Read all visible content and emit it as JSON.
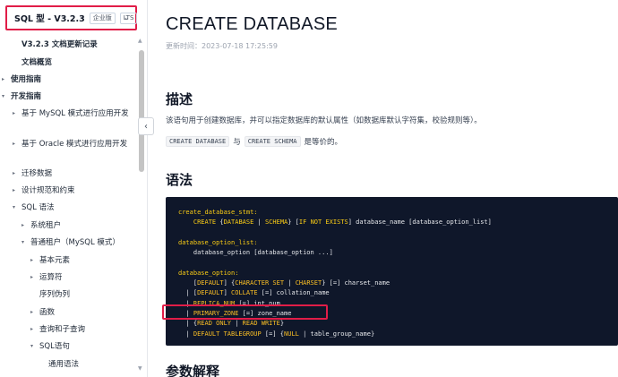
{
  "sidebar": {
    "version": "SQL 型 - V3.2.3",
    "tags": [
      "企业版",
      "LTS"
    ],
    "items": [
      {
        "label": "V3.2.3 文档更新记录",
        "indent": 1,
        "caret": "",
        "bold": true
      },
      {
        "label": "文档概览",
        "indent": 1,
        "caret": "",
        "bold": true
      },
      {
        "label": "使用指南",
        "indent": 0,
        "caret": "▸",
        "bold": true
      },
      {
        "label": "开发指南",
        "indent": 0,
        "caret": "▾",
        "bold": true
      },
      {
        "label": "基于 MySQL 模式进行应用开发",
        "indent": 1,
        "caret": "▸",
        "bold": false
      },
      {
        "label": "基于 Oracle 模式进行应用开发",
        "indent": 1,
        "caret": "▸",
        "bold": false
      },
      {
        "label": "迁移数据",
        "indent": 1,
        "caret": "▸",
        "bold": false
      },
      {
        "label": "设计规范和约束",
        "indent": 1,
        "caret": "▸",
        "bold": false
      },
      {
        "label": "SQL 语法",
        "indent": 1,
        "caret": "▾",
        "bold": false
      },
      {
        "label": "系统租户",
        "indent": 2,
        "caret": "▸",
        "bold": false
      },
      {
        "label": "普通租户（MySQL 模式）",
        "indent": 2,
        "caret": "▾",
        "bold": false
      },
      {
        "label": "基本元素",
        "indent": 3,
        "caret": "▸",
        "bold": false
      },
      {
        "label": "运算符",
        "indent": 3,
        "caret": "▸",
        "bold": false
      },
      {
        "label": "序列伪列",
        "indent": 3,
        "caret": "",
        "bold": false
      },
      {
        "label": "函数",
        "indent": 3,
        "caret": "▸",
        "bold": false
      },
      {
        "label": "查询和子查询",
        "indent": 3,
        "caret": "▸",
        "bold": false
      },
      {
        "label": "SQL语句",
        "indent": 3,
        "caret": "▾",
        "bold": false
      },
      {
        "label": "通用语法",
        "indent": 4,
        "caret": "",
        "bold": false
      }
    ]
  },
  "main": {
    "title": "CREATE DATABASE",
    "updated": "更新时间：2023-07-18 17:25:59",
    "section_desc": "描述",
    "desc_text": "该语句用于创建数据库，并可以指定数据库的默认属性（如数据库默认字符集，校验规则等）。",
    "desc_code1": "CREATE DATABASE",
    "desc_and": "与",
    "desc_code2": "CREATE SCHEMA",
    "desc_tail": "是等价的。",
    "section_syntax": "语法",
    "section_params": "参数解释"
  },
  "code": {
    "l1": "create_database_stmt:",
    "l2a": "    ",
    "l2_create": "CREATE",
    "l2b": " {",
    "l2_db": "DATABASE",
    "l2c": " | ",
    "l2_schema": "SCHEMA",
    "l2d": "} [",
    "l2_ifne": "IF NOT EXISTS",
    "l2e": "] database_name [database_option_list]",
    "l4": "database_option_list:",
    "l5": "    database_option [database_option ...]",
    "l7": "database_option:",
    "l8a": "    [",
    "l8_default": "DEFAULT",
    "l8b": "] {",
    "l8_charset": "CHARACTER SET",
    "l8c": " | ",
    "l8_cs": "CHARSET",
    "l8d": "} [=] charset_name",
    "l9a": "  | [",
    "l9_default": "DEFAULT",
    "l9b": "] ",
    "l9_collate": "COLLATE",
    "l9c": " [=] collation_name",
    "l10a": "  | ",
    "l10_kw": "REPLICA_NUM",
    "l10b": " [=] int_num",
    "l11a": "  | ",
    "l11_kw": "PRIMARY_ZONE",
    "l11b": " [=] zone_name",
    "l12a": "  | {",
    "l12_ro": "READ ONLY",
    "l12b": " | ",
    "l12_rw": "READ WRITE",
    "l12c": "}",
    "l13a": "  | ",
    "l13_kw": "DEFAULT TABLEGROUP",
    "l13b": " [=] {",
    "l13_null": "NULL",
    "l13c": " | table_group_name}"
  },
  "colors": {
    "highlight": "#e11d48",
    "code_bg": "#0f172a",
    "keyword": "#facc15"
  }
}
